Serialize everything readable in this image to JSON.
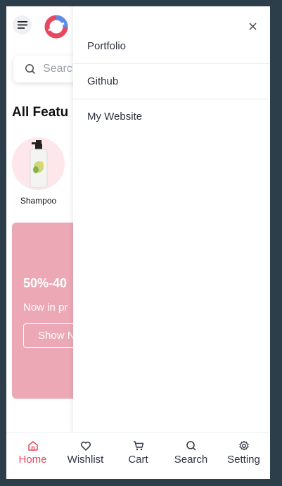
{
  "app": {
    "search_placeholder": "Search",
    "section_title": "All Featu",
    "categories": [
      {
        "label": "Shampoo"
      }
    ],
    "banner": {
      "title": "50%-40",
      "subtitle": "Now in pr",
      "button_label": "Show N"
    }
  },
  "drawer": {
    "items": [
      {
        "label": "Portfolio"
      },
      {
        "label": "Github"
      },
      {
        "label": "My Website"
      }
    ]
  },
  "bottom_nav": {
    "active": "Home",
    "items": [
      {
        "label": "Home"
      },
      {
        "label": "Wishlist"
      },
      {
        "label": "Cart"
      },
      {
        "label": "Search"
      },
      {
        "label": "Setting"
      }
    ]
  },
  "colors": {
    "accent": "#e8475f",
    "banner": "#eca9b5",
    "background": "#2c3e4a"
  }
}
